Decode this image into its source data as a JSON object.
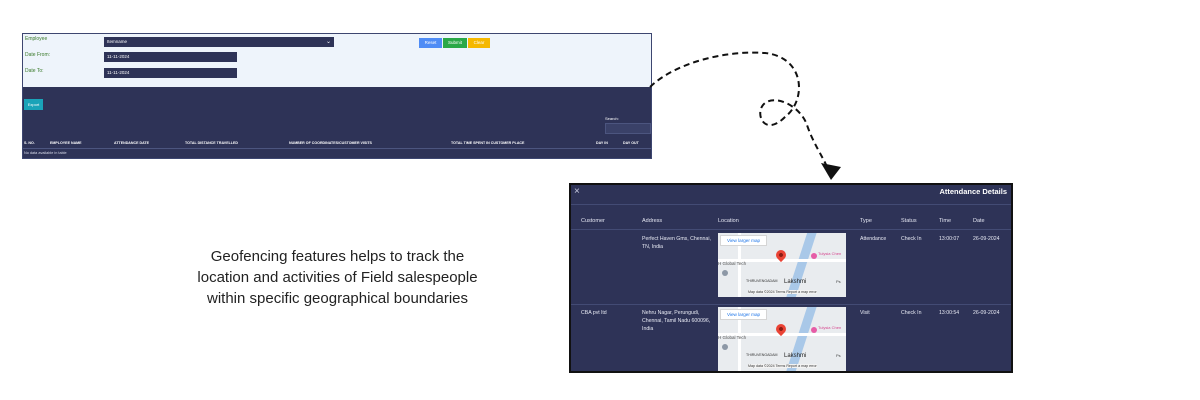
{
  "report": {
    "filter": {
      "employee_label": "Employee",
      "employee_value": "Itemname",
      "date_from_label": "Date From:",
      "date_from_value": "11-11-2024",
      "date_to_label": "Date To:",
      "date_to_value": "11-11-2024",
      "reset_label": "Reset",
      "submit_label": "Submit",
      "clear_label": "Clear"
    },
    "export_label": "Export",
    "search_label": "Search:",
    "columns": [
      "S. NO.",
      "EMPLOYEE NAME",
      "ATTENDANCE DATE",
      "TOTAL DISTANCE TRAVELLED",
      "NUMBER OF COORDINATES/CUSTOMER VISITS",
      "TOTAL TIME SPENT IN CUSTOMER PLACE",
      "DAY IN",
      "DAY OUT"
    ],
    "empty_message": "No data available in table"
  },
  "caption": {
    "line1": "Geofencing features helps to track the",
    "line2": "location and activities of Field salespeople",
    "line3": "within specific geographical boundaries"
  },
  "modal": {
    "title": "Attendance Details",
    "close_glyph": "×",
    "headers": [
      "Customer",
      "Address",
      "Location",
      "Type",
      "Status",
      "Time",
      "Date"
    ],
    "rows": [
      {
        "customer": "",
        "address": "Perfect Haven Gms, Chennai, TN, India",
        "map_link": "View larger map",
        "type": "Attendance",
        "status": "Check In",
        "time": "13:00:07",
        "date": "26-09-2024"
      },
      {
        "customer": "CBA pvt ltd",
        "address": "Nehru Nagar, Perungudi, Chennai, Tamil Nadu 600096, India",
        "map_link": "View larger map",
        "type": "Visit",
        "status": "Check In",
        "time": "13:00:54",
        "date": "26-09-2024"
      }
    ],
    "map_labels": {
      "poi": "Tulysia Chen",
      "area": "THIRUVENGADAM",
      "tech": "H Global Tech",
      "place": "Lakshmi",
      "ps": "Ps",
      "footer": "Map data ©2024  Terms  Report a map error"
    }
  },
  "colors": {
    "panel": "#2e3357",
    "filter_bg": "#eef4fb",
    "reset": "#4f8cf5",
    "submit": "#2aa847",
    "clear": "#f5b800",
    "export": "#1aa3b8"
  }
}
